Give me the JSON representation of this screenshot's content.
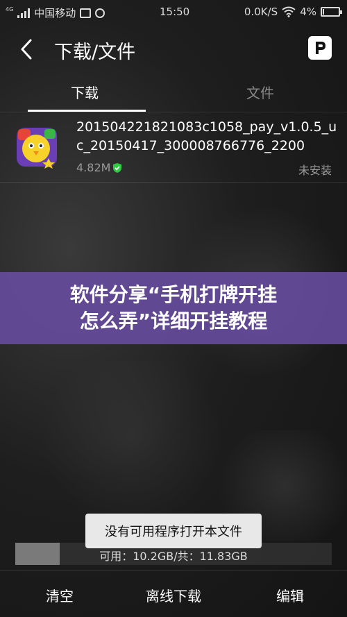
{
  "status_bar": {
    "network": "4G",
    "carrier": "中国移动",
    "time": "15:50",
    "speed": "0.0K/S",
    "battery": "4%"
  },
  "header": {
    "title": "下载/文件"
  },
  "tabs": [
    {
      "label": "下载",
      "active": true
    },
    {
      "label": "文件",
      "active": false
    }
  ],
  "download_item": {
    "filename": "201504221821083c1058_pay_v1.0.5_uc_20150417_300008766776_2200",
    "size": "4.82M",
    "status": "未安装"
  },
  "banner": {
    "line1": "软件分享“手机打牌开挂",
    "line2": "怎么弄”详细开挂教程"
  },
  "toast": {
    "message": "没有可用程序打开本文件"
  },
  "storage": {
    "text": "可用：10.2GB/共：11.83GB",
    "used_fraction": 0.14
  },
  "bottom_bar": {
    "clear": "清空",
    "offline_download": "离线下载",
    "edit": "编辑"
  },
  "colors": {
    "banner": "#684ca0",
    "accent_green": "#2ecc40"
  }
}
